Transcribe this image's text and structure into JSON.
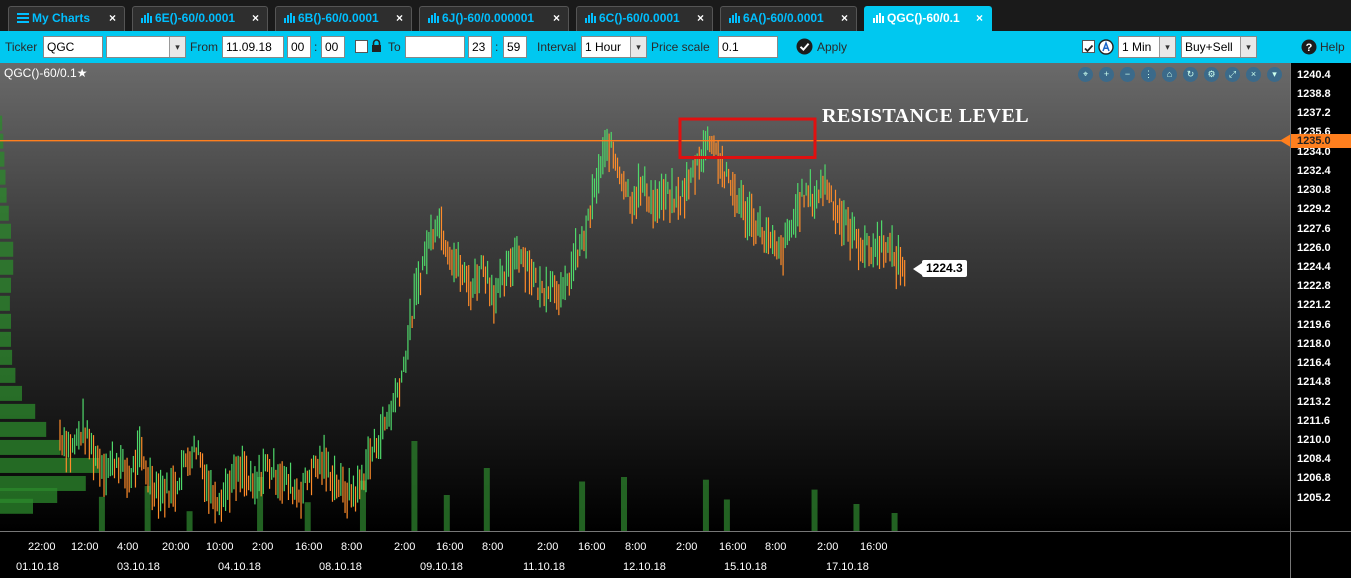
{
  "tabs": [
    {
      "label": "My Charts",
      "icon": "list-icon",
      "active": false
    },
    {
      "label": "6E()-60/0.0001",
      "icon": "bar-chart-icon",
      "active": false
    },
    {
      "label": "6B()-60/0.0001",
      "icon": "bar-chart-icon",
      "active": false
    },
    {
      "label": "6J()-60/0.000001",
      "icon": "bar-chart-icon",
      "active": false
    },
    {
      "label": "6C()-60/0.0001",
      "icon": "bar-chart-icon",
      "active": false
    },
    {
      "label": "6A()-60/0.0001",
      "icon": "bar-chart-icon",
      "active": false
    },
    {
      "label": "QGC()-60/0.1",
      "icon": "bar-chart-icon",
      "active": true
    }
  ],
  "tab_close": "×",
  "toolbar": {
    "ticker_label": "Ticker",
    "ticker_value": "QGC",
    "ticker_extra_value": "",
    "from_label": "From",
    "from_date": "11.09.18",
    "from_hour": "00",
    "from_minute": "00",
    "time_sep": ":",
    "to_label": "To",
    "to_date": "",
    "to_hour": "23",
    "to_minute": "59",
    "interval_label": "Interval",
    "interval_value": "1 Hour",
    "price_scale_label": "Price scale",
    "price_scale_value": "0.1",
    "apply_label": "Apply",
    "timeframe_value": "1 Min",
    "side_value": "Buy+Sell",
    "help_label": "Help",
    "dropdown_glyph": "▾"
  },
  "chart": {
    "title": "QGC()-60/0.1",
    "favorite_glyph": "★",
    "annotation": "RESISTANCE LEVEL",
    "last_price_label": "1224.3",
    "resistance_price_label": "1235.0",
    "tool_glyphs": [
      "⌖",
      "+",
      "−",
      "⋮",
      "⌂",
      "↻",
      "⚙",
      "⤢",
      "×",
      "▾"
    ],
    "colors": {
      "up": "#4fd86a",
      "down": "#ff8c2a",
      "resistance": "#ff7f1e",
      "box": "#e01010",
      "volume": "#2a7a2a"
    }
  },
  "chart_data": {
    "type": "bar",
    "price_ticks": [
      "1240.4",
      "1238.8",
      "1237.2",
      "1235.6",
      "1234.0",
      "1232.4",
      "1230.8",
      "1229.2",
      "1227.6",
      "1226.0",
      "1224.4",
      "1222.8",
      "1221.2",
      "1219.6",
      "1218.0",
      "1216.4",
      "1214.8",
      "1213.2",
      "1211.6",
      "1210.0",
      "1208.4",
      "1206.8",
      "1205.2"
    ],
    "ylim": [
      1204.0,
      1240.8
    ],
    "resistance": 1235.0,
    "last_price": 1224.3,
    "time_ticks": [
      "22:00",
      "12:00",
      "4:00",
      "20:00",
      "10:00",
      "2:00",
      "16:00",
      "8:00",
      "2:00",
      "16:00",
      "8:00",
      "2:00",
      "16:00",
      "8:00",
      "2:00",
      "16:00",
      "8:00",
      "2:00",
      "16:00"
    ],
    "date_ticks": [
      "01.10.18",
      "03.10.18",
      "04.10.18",
      "08.10.18",
      "09.10.18",
      "11.10.18",
      "12.10.18",
      "15.10.18",
      "17.10.18"
    ],
    "price_path": [
      [
        0,
        1210.5
      ],
      [
        0.6,
        1209.2
      ],
      [
        1.2,
        1211.0
      ],
      [
        1.8,
        1209.0
      ],
      [
        2.4,
        1207.6
      ],
      [
        3.0,
        1208.5
      ],
      [
        3.6,
        1206.8
      ],
      [
        4.2,
        1208.9
      ],
      [
        4.8,
        1206.5
      ],
      [
        5.4,
        1205.8
      ],
      [
        6,
        1206.0
      ],
      [
        6.6,
        1208.4
      ],
      [
        7.2,
        1209.6
      ],
      [
        7.8,
        1206.0
      ],
      [
        8.4,
        1205.2
      ],
      [
        9.0,
        1206.6
      ],
      [
        9.6,
        1207.4
      ],
      [
        10.2,
        1205.8
      ],
      [
        10.8,
        1208.0
      ],
      [
        11.4,
        1207.2
      ],
      [
        12,
        1206.4
      ],
      [
        12.6,
        1205.6
      ],
      [
        13.2,
        1207.6
      ],
      [
        13.8,
        1208.2
      ],
      [
        14.4,
        1206.8
      ],
      [
        15,
        1205.6
      ],
      [
        15.6,
        1205.8
      ],
      [
        16.2,
        1208.3
      ],
      [
        16.8,
        1210.5
      ],
      [
        17.4,
        1212.6
      ],
      [
        18,
        1215.8
      ],
      [
        18.6,
        1221.6
      ],
      [
        19.2,
        1225.8
      ],
      [
        19.8,
        1228.6
      ],
      [
        20.4,
        1226.0
      ],
      [
        21,
        1224.2
      ],
      [
        21.6,
        1222.6
      ],
      [
        22.2,
        1224.8
      ],
      [
        22.8,
        1222.0
      ],
      [
        23.4,
        1223.6
      ],
      [
        24,
        1226.0
      ],
      [
        24.6,
        1224.6
      ],
      [
        25.2,
        1222.4
      ],
      [
        25.8,
        1223.4
      ],
      [
        26.4,
        1222.0
      ],
      [
        27,
        1225.0
      ],
      [
        27.6,
        1227.2
      ],
      [
        28.2,
        1231.8
      ],
      [
        28.8,
        1234.8
      ],
      [
        29.4,
        1232.4
      ],
      [
        30,
        1230.0
      ],
      [
        30.6,
        1231.2
      ],
      [
        31.2,
        1229.6
      ],
      [
        31.8,
        1230.4
      ],
      [
        32.4,
        1229.8
      ],
      [
        33,
        1231.4
      ],
      [
        33.6,
        1233.8
      ],
      [
        34.2,
        1235.3
      ],
      [
        34.8,
        1232.4
      ],
      [
        35.4,
        1230.6
      ],
      [
        36,
        1229.0
      ],
      [
        36.6,
        1228.0
      ],
      [
        37.2,
        1226.6
      ],
      [
        37.8,
        1225.4
      ],
      [
        38.4,
        1227.8
      ],
      [
        39,
        1230.6
      ],
      [
        39.6,
        1230.2
      ],
      [
        40.2,
        1231.6
      ],
      [
        40.8,
        1229.0
      ],
      [
        41.4,
        1227.6
      ],
      [
        42,
        1226.4
      ],
      [
        42.6,
        1225.8
      ],
      [
        43.2,
        1226.6
      ],
      [
        43.8,
        1225.2
      ],
      [
        44.4,
        1224.3
      ]
    ],
    "price_range": [
      [
        0,
        1210.5
      ],
      [
        0.6,
        1209.2
      ],
      [
        1.2,
        1211.0
      ],
      [
        1.8,
        1209.0
      ],
      [
        2.4,
        1207.6
      ],
      [
        3.0,
        1208.5
      ],
      [
        3.6,
        1206.8
      ],
      [
        4.2,
        1208.9
      ],
      [
        4.8,
        1206.5
      ],
      [
        5.4,
        1205.8
      ],
      [
        6,
        1206.0
      ],
      [
        6.6,
        1208.4
      ],
      [
        7.2,
        1209.6
      ],
      [
        7.8,
        1206.0
      ],
      [
        8.4,
        1205.2
      ],
      [
        9.0,
        1206.6
      ],
      [
        9.6,
        1207.4
      ],
      [
        10.2,
        1205.8
      ],
      [
        10.8,
        1208.0
      ],
      [
        11.4,
        1207.2
      ],
      [
        12,
        1206.4
      ],
      [
        12.6,
        1205.6
      ],
      [
        13.2,
        1207.6
      ],
      [
        13.8,
        1208.2
      ],
      [
        14.4,
        1206.8
      ],
      [
        15,
        1205.6
      ],
      [
        15.6,
        1205.8
      ],
      [
        16.2,
        1208.3
      ],
      [
        16.8,
        1210.5
      ],
      [
        17.4,
        1212.6
      ],
      [
        18,
        1215.8
      ],
      [
        18.6,
        1221.6
      ],
      [
        19.2,
        1225.8
      ],
      [
        19.8,
        1228.6
      ],
      [
        20.4,
        1226.0
      ],
      [
        21,
        1224.2
      ],
      [
        21.6,
        1222.6
      ],
      [
        22.2,
        1224.8
      ],
      [
        22.8,
        1222.0
      ],
      [
        23.4,
        1223.6
      ],
      [
        24,
        1226.0
      ],
      [
        24.6,
        1224.6
      ],
      [
        25.2,
        1222.4
      ],
      [
        25.8,
        1223.4
      ],
      [
        26.4,
        1222.0
      ],
      [
        27,
        1225.0
      ],
      [
        27.6,
        1227.2
      ],
      [
        28.2,
        1231.8
      ],
      [
        28.8,
        1234.8
      ],
      [
        29.4,
        1232.4
      ],
      [
        30,
        1230.0
      ],
      [
        30.6,
        1231.2
      ],
      [
        31.2,
        1229.6
      ],
      [
        31.8,
        1230.4
      ],
      [
        32.4,
        1229.8
      ],
      [
        33,
        1231.4
      ],
      [
        33.6,
        1233.8
      ],
      [
        34.2,
        1235.3
      ],
      [
        34.8,
        1232.4
      ],
      [
        35.4,
        1230.6
      ],
      [
        36,
        1229.0
      ],
      [
        36.6,
        1228.0
      ],
      [
        37.2,
        1226.6
      ],
      [
        37.8,
        1225.4
      ],
      [
        38.4,
        1227.8
      ],
      [
        39,
        1230.6
      ],
      [
        39.6,
        1230.2
      ],
      [
        40.2,
        1231.6
      ],
      [
        40.8,
        1229.0
      ],
      [
        41.4,
        1227.6
      ],
      [
        42,
        1226.4
      ],
      [
        42.6,
        1225.8
      ],
      [
        43.2,
        1226.6
      ],
      [
        43.8,
        1225.2
      ],
      [
        44.4,
        1224.3
      ]
    ],
    "volume_profile": [
      [
        1236.5,
        0.2
      ],
      [
        1235.0,
        0.3
      ],
      [
        1233.5,
        0.4
      ],
      [
        1232.0,
        0.5
      ],
      [
        1230.5,
        0.6
      ],
      [
        1229.0,
        0.8
      ],
      [
        1227.5,
        1.0
      ],
      [
        1226.0,
        1.2
      ],
      [
        1224.5,
        1.2
      ],
      [
        1223.0,
        1.0
      ],
      [
        1221.5,
        0.9
      ],
      [
        1220.0,
        1.0
      ],
      [
        1218.5,
        1.0
      ],
      [
        1217.0,
        1.1
      ],
      [
        1215.5,
        1.4
      ],
      [
        1214.0,
        2.0
      ],
      [
        1212.5,
        3.2
      ],
      [
        1211.0,
        4.2
      ],
      [
        1209.5,
        5.5
      ],
      [
        1208.0,
        9.0
      ],
      [
        1206.5,
        7.8
      ],
      [
        1205.5,
        5.2
      ],
      [
        1204.6,
        3.0
      ]
    ],
    "volumes": [
      [
        2.2,
        38
      ],
      [
        4.6,
        50
      ],
      [
        6.8,
        22
      ],
      [
        10.5,
        60
      ],
      [
        13.0,
        32
      ],
      [
        15.9,
        56
      ],
      [
        18.6,
        100
      ],
      [
        20.3,
        40
      ],
      [
        22.4,
        70
      ],
      [
        27.4,
        55
      ],
      [
        29.6,
        60
      ],
      [
        33.9,
        57
      ],
      [
        35.0,
        35
      ],
      [
        39.6,
        46
      ],
      [
        41.8,
        30
      ],
      [
        43.8,
        20
      ]
    ]
  }
}
